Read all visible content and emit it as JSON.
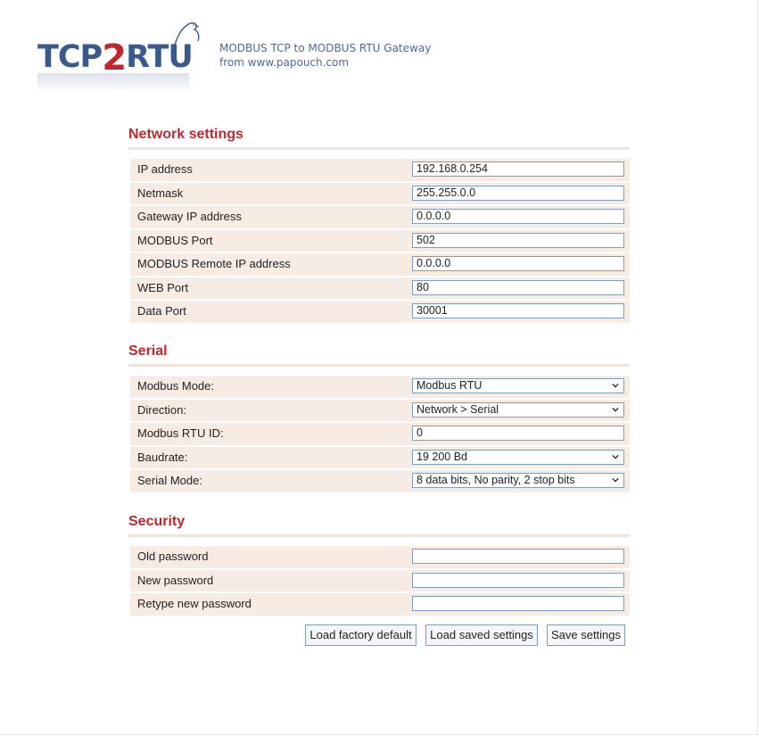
{
  "header": {
    "logo_text_a": "TCP",
    "logo_text_2": "2",
    "logo_text_b": "RTU",
    "tagline_line1": "MODBUS TCP to MODBUS RTU Gateway",
    "tagline_line2": "from www.papouch.com"
  },
  "network": {
    "title": "Network settings",
    "rows": [
      {
        "label": "IP address",
        "value": "192.168.0.254"
      },
      {
        "label": "Netmask",
        "value": "255.255.0.0"
      },
      {
        "label": "Gateway IP address",
        "value": "0.0.0.0"
      },
      {
        "label": "MODBUS Port",
        "value": "502"
      },
      {
        "label": "MODBUS Remote IP address",
        "value": "0.0.0.0"
      },
      {
        "label": "WEB Port",
        "value": "80"
      },
      {
        "label": "Data Port",
        "value": "30001"
      }
    ]
  },
  "serial": {
    "title": "Serial",
    "rows": [
      {
        "label": "Modbus Mode:",
        "value": "Modbus RTU"
      },
      {
        "label": "Direction:",
        "value": "Network > Serial"
      },
      {
        "label": "Modbus RTU ID:",
        "value": "0"
      },
      {
        "label": "Baudrate:",
        "value": "19 200 Bd"
      },
      {
        "label": "Serial Mode:",
        "value": "8 data bits, No parity, 2 stop bits"
      }
    ]
  },
  "security": {
    "title": "Security",
    "rows": [
      {
        "label": "Old password",
        "value": ""
      },
      {
        "label": "New password",
        "value": ""
      },
      {
        "label": "Retype new password",
        "value": ""
      }
    ]
  },
  "buttons": {
    "factory": "Load factory default",
    "saved": "Load saved settings",
    "save": "Save settings"
  }
}
